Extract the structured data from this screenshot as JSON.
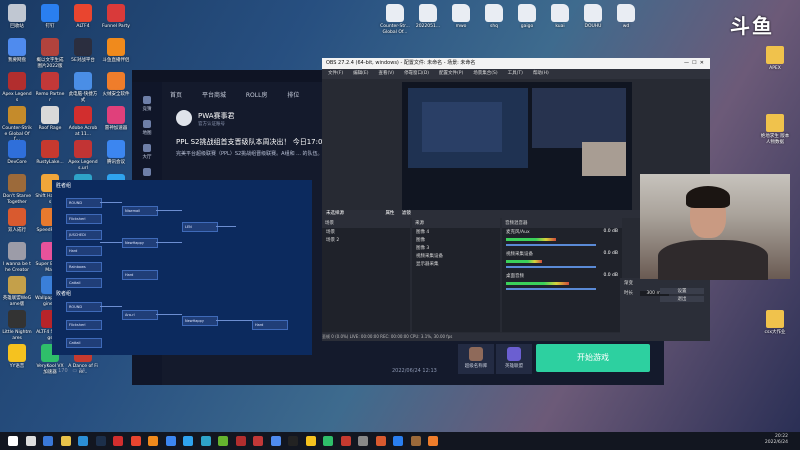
{
  "desktop_icons_left": [
    {
      "label": "回收站",
      "color": "#c0c7d2"
    },
    {
      "label": "钉钉",
      "color": "#2a7ff0"
    },
    {
      "label": "ALTF4",
      "color": "#e9452f"
    },
    {
      "label": "Funnel Party",
      "color": "#d93a3a"
    },
    {
      "label": "我要网盘",
      "color": "#4f8bee"
    },
    {
      "label": "概以文字生成图片2022版",
      "color": "#b2433d"
    },
    {
      "label": "5E对战平台",
      "color": "#2b2e3f"
    },
    {
      "label": "斗鱼直播伴侣",
      "color": "#f08a1c"
    },
    {
      "label": "Apex Legends",
      "color": "#b22e2e"
    },
    {
      "label": "Remo Partner",
      "color": "#c23838"
    },
    {
      "label": "此电脑-快捷方式",
      "color": "#4a8ee6"
    },
    {
      "label": "火绒安全软件",
      "color": "#ef7d2b"
    },
    {
      "label": "Counter-Strike Global Off...",
      "color": "#c58b2b"
    },
    {
      "label": "Roof Rage",
      "color": "#d9d9d9"
    },
    {
      "label": "Adobe Acrobat 11...",
      "color": "#d22e2e"
    },
    {
      "label": "雷神加速器",
      "color": "#e0407b"
    },
    {
      "label": "DevCore",
      "color": "#2f6fda"
    },
    {
      "label": "RustyLake...",
      "color": "#c7392f"
    },
    {
      "label": "Apex Legends.url",
      "color": "#c23434"
    },
    {
      "label": "腾讯会议",
      "color": "#3c86f0"
    },
    {
      "label": "Don't Starve Together",
      "color": "#9c6a3a"
    },
    {
      "label": "Shift Happens",
      "color": "#f0a63a"
    },
    {
      "label": "EVE模拟器",
      "color": "#2ea3c8"
    },
    {
      "label": "腾讯视频",
      "color": "#2fa3ee"
    },
    {
      "label": "双人成行",
      "color": "#d95a2f"
    },
    {
      "label": "SpeedRun...",
      "color": "#e87a2e"
    },
    {
      "label": "GeForce Experience",
      "color": "#65b32e"
    },
    {
      "label": "英雄联盟WeGame平台",
      "color": "#d7ac44"
    },
    {
      "label": "I wanna be the Creator",
      "color": "#9c9ca8"
    },
    {
      "label": "Super Bunny Man",
      "color": "#e7529b"
    },
    {
      "label": "Microsoft Edge",
      "color": "#2b8fd6"
    },
    {
      "label": "Origin",
      "color": "#ee6b2d"
    },
    {
      "label": "英雄联盟WeGame版",
      "color": "#c4a04a"
    },
    {
      "label": "Wallpaper Engine...",
      "color": "#3a7fd9"
    },
    {
      "label": "Steam",
      "color": "#1c2f4a"
    },
    {
      "label": "Logitech G HUB",
      "color": "#222"
    },
    {
      "label": "Little Nightmares",
      "color": "#333"
    },
    {
      "label": "ALTF4 Settings",
      "color": "#b8242a"
    },
    {
      "label": "英雄联盟",
      "color": "#2a3a5a"
    },
    {
      "label": "Plants vs. Zombies G...",
      "color": "#2e9e3a"
    },
    {
      "label": "YY语音",
      "color": "#f5c21f"
    },
    {
      "label": "VeryKool VX加速器",
      "color": "#2fbf6a"
    },
    {
      "label": "A Dance of Fire...",
      "color": "#c63a2f"
    }
  ],
  "desktop_icons_top": [
    {
      "label": "Counter-Str... Global Of...",
      "color": "#e9edf3"
    },
    {
      "label": "2022051...",
      "color": "#e9edf3"
    },
    {
      "label": "mwo",
      "color": "#e9edf3"
    },
    {
      "label": "shq",
      "color": "#e9edf3"
    },
    {
      "label": "gaigo",
      "color": "#e9edf3"
    },
    {
      "label": "kuai",
      "color": "#e9edf3"
    },
    {
      "label": "DOUHU",
      "color": "#e9edf3"
    },
    {
      "label": "wd",
      "color": "#e9edf3"
    }
  ],
  "desktop_icons_right": [
    {
      "label": "APEX"
    },
    {
      "label": "绝地求生 版本人物数据"
    },
    {
      "label": "SettingFiles"
    },
    {
      "label": "csx大作业"
    }
  ],
  "brand_logo": "斗鱼",
  "app": {
    "tabs": [
      "首页",
      "平台商城",
      "ROLL房",
      "排位"
    ],
    "side_items": [
      "竞猜",
      "地图",
      "大厅",
      "",
      "",
      "",
      "",
      "",
      "",
      "扫描工具",
      ""
    ],
    "post": {
      "author": "PWA赛事君",
      "author_sub": "官方认证账号",
      "title": "PPL S2挑战组首支晋级队本周决出！ 今日17:00",
      "body": "完美平台超级联赛（PPL）S2挑战组晋级联赛。A组和 ... 的队伍。今日17:00将由Hard对阵Ara-rl，以及 ... 全文",
      "likes": "170",
      "comments": "34",
      "date": "2022/06/24 12:13"
    },
    "bracket_title": "胜者组",
    "bracket_title2": "败者组",
    "teams": [
      "ROUND",
      "Flicksherl",
      "JUSCHEDI",
      "Hard",
      "Rainbows",
      "Cattail",
      "Nisemail",
      "NewHappy",
      "Hard",
      "LEN",
      "ROUND",
      "Flicksherl",
      "Cattail",
      "Ara-rl",
      "NewHappy",
      "Hard"
    ],
    "btn_left": "超级名称库",
    "btn_mid": "英雄联盟",
    "start_button": "开始游戏"
  },
  "obs": {
    "title": "OBS 27.2.4 (64-bit, windows) - 配置文件: 未命名 - 场景: 未命名",
    "menu": [
      "文件(F)",
      "编辑(E)",
      "查看(V)",
      "停靠窗口(D)",
      "配置文件(P)",
      "场景集合(S)",
      "工具(T)",
      "帮助(H)"
    ],
    "preview_label": "未选择源",
    "props_label": "属性",
    "filter_label": "滤镜",
    "scenes_head": "场景",
    "scenes": [
      "场景",
      "场景 2"
    ],
    "sources_head": "来源",
    "sources": [
      "图像 4",
      "图像",
      "图像 3",
      "视频采集设备",
      "显示器采集"
    ],
    "mixer_head": "音频混音器",
    "mixer": [
      {
        "name": "麦克风/Aux",
        "db": "0.0 dB",
        "level": 0.55
      },
      {
        "name": "视频采集设备",
        "db": "0.0 dB",
        "level": 0.4
      },
      {
        "name": "桌面音频",
        "db": "0.0 dB",
        "level": 0.7
      }
    ],
    "controls": [
      "设置",
      "退出"
    ],
    "transition_label": "渐变",
    "duration_label": "时长",
    "duration_value": "300 ms",
    "status": "丢帧 0 (0.0%)   LIVE: 00:00:00   REC: 00:00:00   CPU: 3.1%, 30.00 fps"
  },
  "clock": {
    "time": "20:22",
    "date": "2022/6/24"
  }
}
